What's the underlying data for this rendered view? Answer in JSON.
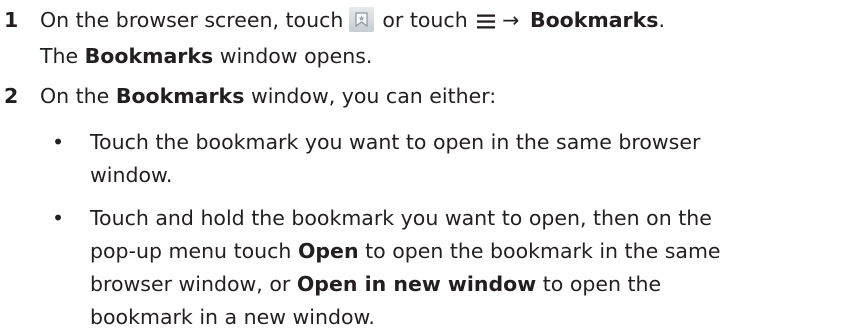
{
  "steps": [
    {
      "number": "1",
      "line1": {
        "pre": "On the browser screen, touch",
        "mid": "or touch",
        "arrow": "→",
        "bold": "Bookmarks",
        "end": "."
      },
      "line2": {
        "pre": "The",
        "bold": "Bookmarks",
        "post": "window opens."
      },
      "icons": [
        "bookmark-icon",
        "menu-icon"
      ]
    },
    {
      "number": "2",
      "line1": {
        "pre": "On the",
        "bold": "Bookmarks",
        "post": "window, you can either:"
      },
      "bullets": [
        {
          "symbol": "•",
          "lines": [
            "Touch the bookmark you want to open in the same browser",
            "window."
          ]
        },
        {
          "symbol": "•",
          "line1": "Touch and hold the bookmark you want to open, then on the",
          "line2": {
            "pre": "pop-up menu touch",
            "bold": "Open",
            "post": "to open the bookmark in the same"
          },
          "line3": {
            "pre": "browser window, or",
            "bold": "Open in new window",
            "post": "to open the"
          },
          "line4": "bookmark in a new window."
        }
      ]
    }
  ]
}
